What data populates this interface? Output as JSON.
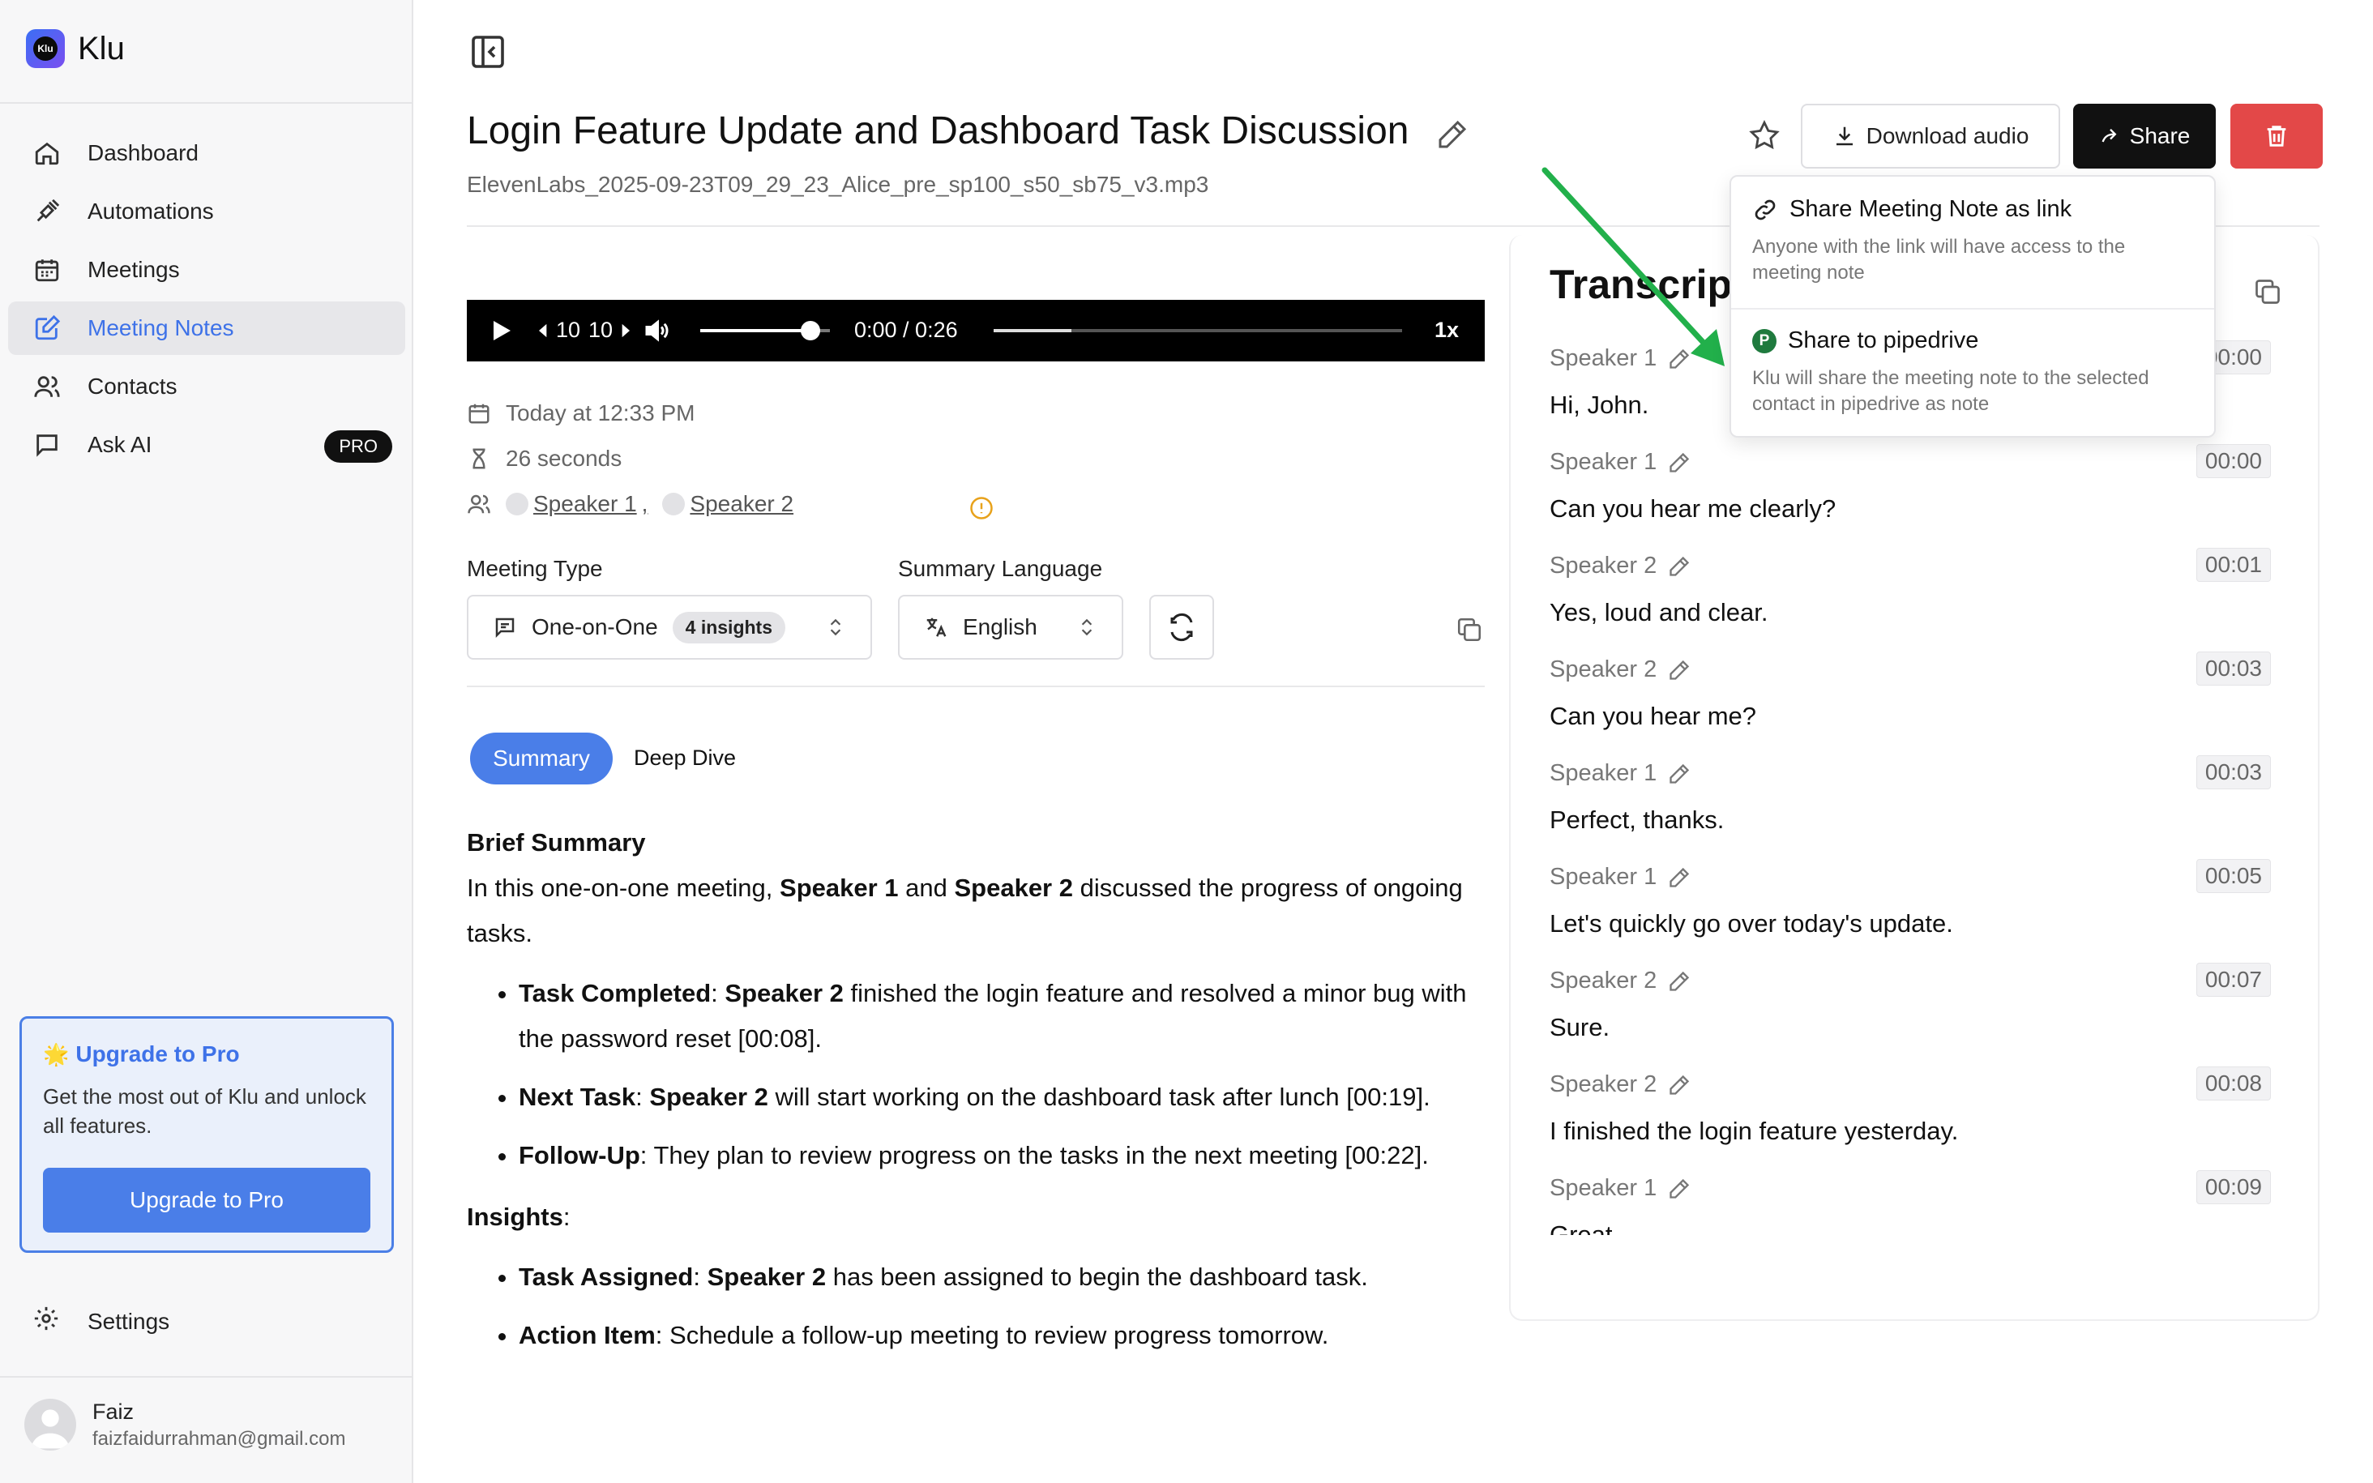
{
  "app": {
    "name": "Klu",
    "logo_mark": "Klu"
  },
  "sidebar": {
    "items": [
      {
        "label": "Dashboard",
        "icon": "home-icon"
      },
      {
        "label": "Automations",
        "icon": "plug-icon"
      },
      {
        "label": "Meetings",
        "icon": "calendar-icon"
      },
      {
        "label": "Meeting Notes",
        "icon": "note-edit-icon",
        "active": true
      },
      {
        "label": "Contacts",
        "icon": "users-icon"
      },
      {
        "label": "Ask AI",
        "icon": "chat-icon",
        "badge": "PRO"
      }
    ],
    "upgrade": {
      "title": "Upgrade to Pro",
      "description": "Get the most out of Klu and unlock all features.",
      "button": "Upgrade to Pro"
    },
    "settings_label": "Settings",
    "user": {
      "name": "Faiz",
      "email": "faizfaidurrahman@gmail.com"
    }
  },
  "header": {
    "title": "Login Feature Update and Dashboard Task Discussion",
    "filename": "ElevenLabs_2025-09-23T09_29_23_Alice_pre_sp100_s50_sb75_v3.mp3",
    "download_label": "Download audio",
    "share_label": "Share"
  },
  "player": {
    "rewind": "10",
    "forward": "10",
    "time": "0:00 / 0:26",
    "speed": "1x",
    "volume_level": 0.85,
    "buffer_level": 0.19
  },
  "meta": {
    "date": "Today at 12:33 PM",
    "duration": "26 seconds",
    "speakers": [
      "Speaker 1",
      "Speaker 2"
    ]
  },
  "controls": {
    "meeting_type_label": "Meeting Type",
    "meeting_type_value": "One-on-One",
    "insights_badge": "4 insights",
    "summary_language_label": "Summary Language",
    "summary_language_value": "English"
  },
  "tabs": {
    "summary": "Summary",
    "deep_dive": "Deep Dive"
  },
  "summary": {
    "brief_heading": "Brief Summary",
    "brief": {
      "t1": "In this one-on-one meeting, ",
      "s1": "Speaker 1",
      "t2": " and ",
      "s2": "Speaker 2",
      "t3": " discussed the progress of ongoing tasks."
    },
    "bullets": [
      {
        "label": "Task Completed",
        "sep": ": ",
        "speaker": "Speaker 2",
        "text": " finished the login feature and resolved a minor bug with the password reset [00:08]."
      },
      {
        "label": "Next Task",
        "sep": ": ",
        "speaker": "Speaker 2",
        "text": " will start working on the dashboard task after lunch [00:19]."
      },
      {
        "label": "Follow-Up",
        "sep": ": ",
        "text": "They plan to review progress on the tasks in the next meeting [00:22]."
      }
    ],
    "insights_heading": "Insights",
    "insights_colon": ":",
    "insights": [
      {
        "label": "Task Assigned",
        "sep": ": ",
        "speaker": "Speaker 2",
        "text": " has been assigned to begin the dashboard task."
      },
      {
        "label": "Action Item",
        "sep": ": ",
        "text": "Schedule a follow-up meeting to review progress tomorrow."
      }
    ]
  },
  "transcript": {
    "title": "Transcript",
    "items": [
      {
        "speaker": "Speaker 1",
        "time": "00:00",
        "text": "Hi, John."
      },
      {
        "speaker": "Speaker 1",
        "time": "00:00",
        "text": "Can you hear me clearly?"
      },
      {
        "speaker": "Speaker 2",
        "time": "00:01",
        "text": "Yes, loud and clear."
      },
      {
        "speaker": "Speaker 2",
        "time": "00:03",
        "text": "Can you hear me?"
      },
      {
        "speaker": "Speaker 1",
        "time": "00:03",
        "text": "Perfect, thanks."
      },
      {
        "speaker": "Speaker 1",
        "time": "00:05",
        "text": "Let's quickly go over today's update."
      },
      {
        "speaker": "Speaker 2",
        "time": "00:07",
        "text": "Sure."
      },
      {
        "speaker": "Speaker 2",
        "time": "00:08",
        "text": "I finished the login feature yesterday."
      },
      {
        "speaker": "Speaker 1",
        "time": "00:09",
        "text": "Great."
      }
    ]
  },
  "share_menu": {
    "link_title": "Share Meeting Note as link",
    "link_desc": "Anyone with the link will have access to the meeting note",
    "pipedrive_icon_letter": "P",
    "pipedrive_title": "Share to pipedrive",
    "pipedrive_desc": "Klu will share the meeting note to the selected contact in pipedrive as note"
  },
  "colors": {
    "accent": "#4a7ee8",
    "danger": "#e34848",
    "annotation_arrow": "#22b04b"
  }
}
